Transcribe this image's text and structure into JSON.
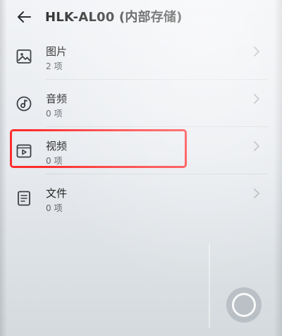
{
  "header": {
    "title": "HLK-AL00 (内部存储)",
    "back_icon": "back-arrow-icon"
  },
  "items": [
    {
      "label": "图片",
      "count": "2 项",
      "icon": "image-icon"
    },
    {
      "label": "音频",
      "count": "0 项",
      "icon": "audio-disc-icon"
    },
    {
      "label": "视频",
      "count": "0 项",
      "icon": "video-icon"
    },
    {
      "label": "文件",
      "count": "0 项",
      "icon": "document-icon"
    }
  ],
  "colors": {
    "highlight": "#ff2d2d",
    "icon": "#3c4043",
    "chevron": "#b0b4b8"
  },
  "floating_button_icon": "assistive-touch-circle-icon"
}
